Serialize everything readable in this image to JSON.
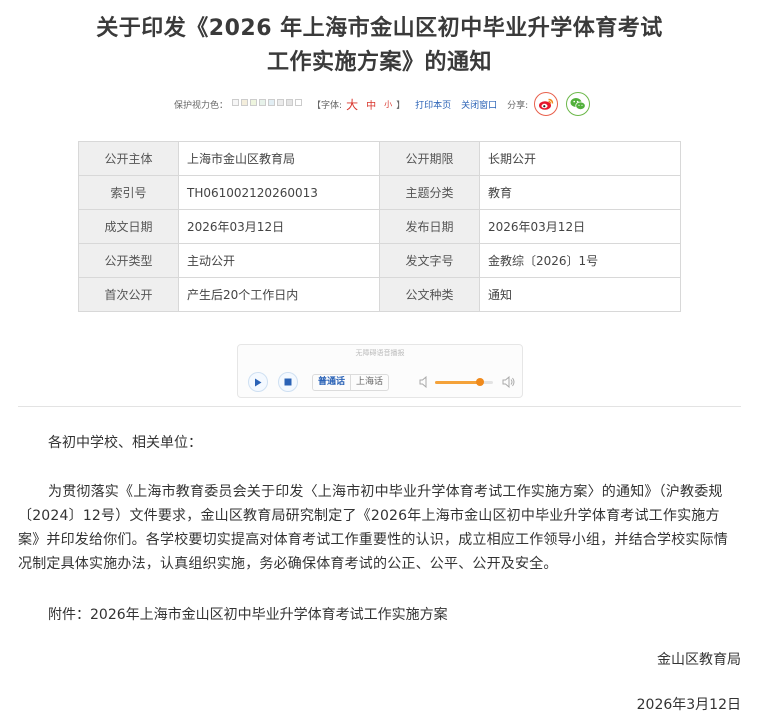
{
  "title": {
    "line1": "关于印发《2026 年上海市金山区初中毕业升学体育考试",
    "line2": "工作实施方案》的通知"
  },
  "toolbar": {
    "protect_label": "保护视力色：",
    "swatch_colors": [
      "#f6f6f6",
      "#f4eedc",
      "#eef5de",
      "#e7f2ea",
      "#e2eef4",
      "#ececec",
      "#e4e4e4",
      "#ffffff"
    ],
    "font_label": "【字体:",
    "font_big": "大",
    "font_mid": "中",
    "font_small": "小",
    "font_close": "】",
    "print_label": "打印本页",
    "close_label": "关闭窗口",
    "share_label": "分享:",
    "weibo_icon": "weibo-icon",
    "wechat_icon": "wechat-icon"
  },
  "meta": {
    "rows": [
      {
        "k1": "公开主体",
        "v1": "上海市金山区教育局",
        "k2": "公开期限",
        "v2": "长期公开"
      },
      {
        "k1": "索引号",
        "v1": "TH061002120260013",
        "k2": "主题分类",
        "v2": "教育"
      },
      {
        "k1": "成文日期",
        "v1": "2026年03月12日",
        "k2": "发布日期",
        "v2": "2026年03月12日"
      },
      {
        "k1": "公开类型",
        "v1": "主动公开",
        "k2": "发文字号",
        "v2": "金教综〔2026〕1号"
      },
      {
        "k1": "首次公开",
        "v1": "产生后20个工作日内",
        "k2": "公文种类",
        "v2": "通知"
      }
    ]
  },
  "player": {
    "hint": "无障碍语音播报",
    "lang_active": "普通话",
    "lang_other": "上海话",
    "volume": 0.78
  },
  "content": {
    "greeting": "各初中学校、相关单位：",
    "paragraph": "为贯彻落实《上海市教育委员会关于印发〈上海市初中毕业升学体育考试工作实施方案〉的通知》（沪教委规〔2024〕12号）文件要求，金山区教育局研究制定了《2026年上海市金山区初中毕业升学体育考试工作实施方案》并印发给你们。各学校要切实提高对体育考试工作重要性的认识，成立相应工作领导小组，并结合学校实际情况制定具体实施办法，认真组织实施，务必确保体育考试的公正、公平、公开及安全。",
    "attachment": "附件：2026年上海市金山区初中毕业升学体育考试工作实施方案",
    "org": "金山区教育局",
    "date": "2026年3月12日"
  },
  "colors": {
    "accent_red": "#d9342b",
    "link_blue": "#2a62b6",
    "volume_orange": "#f08a1c"
  }
}
